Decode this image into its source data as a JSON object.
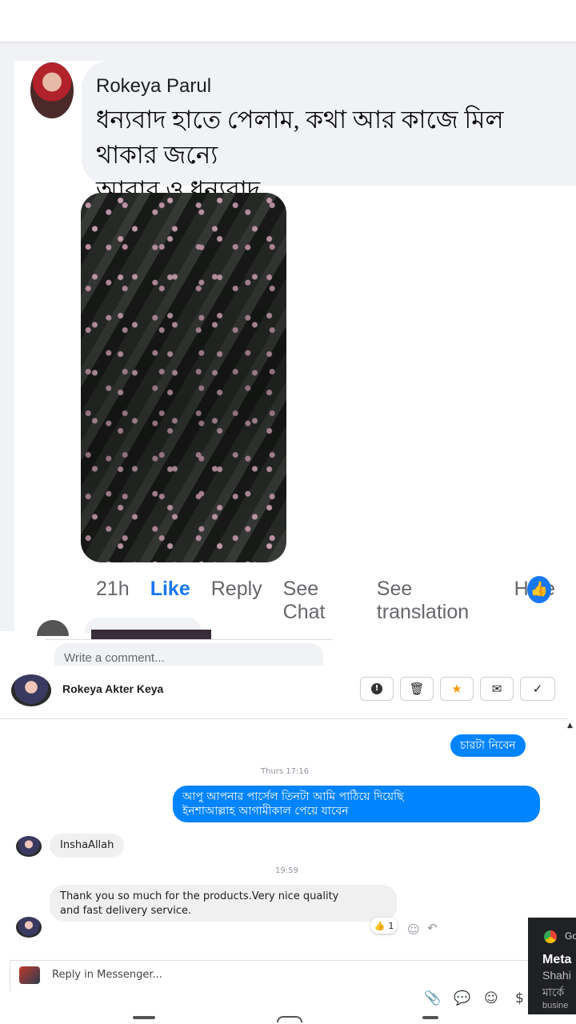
{
  "fb_comment": {
    "commenter": "Rokeya Parul",
    "text_line1": "ধন্যবাদ হাতে পেলাম, কথা আর কাজে মিল থাকার জন্যে",
    "text_line2": "আবার ও ধন্যবাদ",
    "time": "21h",
    "actions": [
      "Like",
      "Reply",
      "See Chat",
      "See translation",
      "Hide"
    ],
    "reaction_icon": "like-thumb-icon",
    "write_placeholder": "Write a comment..."
  },
  "messenger": {
    "contact_name": "Rokeya Akter Keya",
    "toolbar_icons": [
      "alert-icon",
      "trash-icon",
      "star-icon",
      "mail-icon",
      "check-icon"
    ],
    "messages": {
      "out1": "চারটা নিবেন",
      "time1": "Thurs 17:16",
      "out2_line1": "আপু আপনার পার্সেল তিনটা আমি পাঠিয়ে দিয়েছি",
      "out2_line2": "ইনশাআল্লাহ আগামীকাল পেয়ে যাবেন",
      "in1": "InshaAllah",
      "time2": "19:59",
      "in2_line1": "Thank you so much for the products.Very nice quality",
      "in2_line2": "and fast delivery service.",
      "reaction_count": "1"
    },
    "reply_placeholder": "Reply in Messenger...",
    "accent_color": "#0084ff"
  },
  "notification": {
    "source": "Go",
    "title": "Meta",
    "line1": "Shahi",
    "line2": "মার্কে",
    "footer": "busine"
  }
}
